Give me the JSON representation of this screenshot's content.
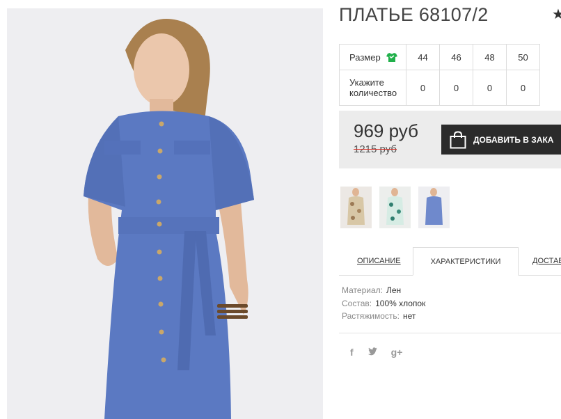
{
  "product": {
    "title": "ПЛАТЬЕ 68107/2",
    "favorite_icon": "star-icon",
    "image_alt": "dress-photo"
  },
  "sizes": {
    "row_label": "Размер",
    "size_icon": "tshirt-icon",
    "list": [
      "44",
      "46",
      "48",
      "50"
    ],
    "qty_label_line1": "Укажите",
    "qty_label_line2": "количество",
    "quantities": [
      "0",
      "0",
      "0",
      "0"
    ]
  },
  "price": {
    "current": "969 руб",
    "old": "1215 руб",
    "cart_button": "ДОБАВИТЬ В ЗАКА",
    "cart_icon": "shopping-bag-icon"
  },
  "thumbnails": [
    "floral-beige-dress-thumb",
    "floral-mint-dress-thumb",
    "blue-dress-thumb"
  ],
  "tabs": {
    "description": "ОПИСАНИЕ",
    "characteristics": "ХАРАКТЕРИСТИКИ",
    "delivery": "ДОСТАВ"
  },
  "specs": [
    {
      "key": "Материал:",
      "value": "Лен"
    },
    {
      "key": "Состав:",
      "value": "100% хлопок"
    },
    {
      "key": "Растяжимость:",
      "value": "нет"
    }
  ],
  "social": {
    "facebook": "f",
    "twitter_icon": "twitter-icon",
    "google_plus": "g+"
  },
  "colors": {
    "dress": "#5b79c2",
    "button_bg": "#2b2b2b",
    "price_box_bg": "#ececec",
    "old_price_strike": "#d9342b",
    "size_icon": "#21b04b"
  }
}
